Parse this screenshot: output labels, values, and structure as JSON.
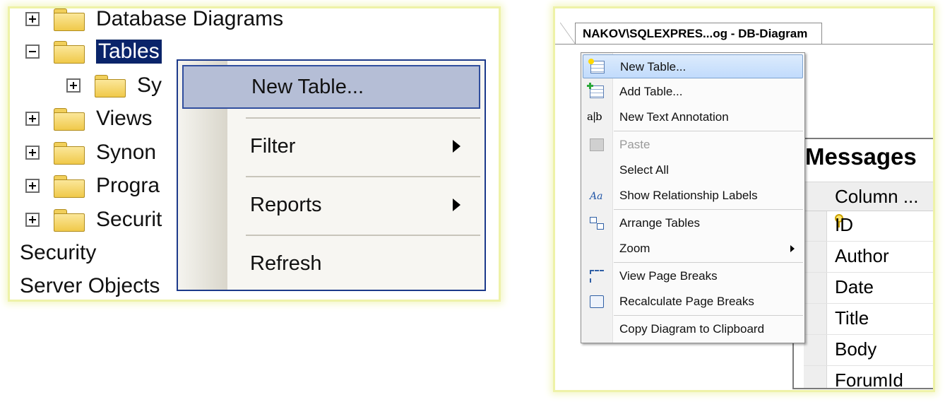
{
  "left": {
    "tree": [
      {
        "label": "Database Diagrams",
        "expander": "plus",
        "folder": true
      },
      {
        "label": "Tables",
        "expander": "minus",
        "folder": true,
        "selected": true
      },
      {
        "label": "Sy",
        "expander": "plus",
        "folder": true
      },
      {
        "label": "Views",
        "expander": "plus",
        "folder": true
      },
      {
        "label": "Synon",
        "expander": "plus",
        "folder": true
      },
      {
        "label": "Progra",
        "expander": "plus",
        "folder": true
      },
      {
        "label": "Securit",
        "expander": "plus",
        "folder": true
      },
      {
        "label": "Security",
        "expander": "none",
        "folder": false
      },
      {
        "label": "Server Objects",
        "expander": "none",
        "folder": false
      }
    ],
    "context_menu": {
      "items": [
        {
          "label": "New Table...",
          "highlighted": true,
          "submenu": false
        },
        {
          "label": "Filter",
          "submenu": true
        },
        {
          "label": "Reports",
          "submenu": true
        },
        {
          "label": "Refresh",
          "submenu": false
        }
      ]
    }
  },
  "right": {
    "tab_title": "NAKOV\\SQLEXPRES...og - DB-Diagram",
    "table": {
      "name": "Messages",
      "column_header": "Column ...",
      "rows": [
        "ID",
        "Author",
        "Date",
        "Title",
        "Body",
        "ForumId"
      ],
      "primary_key": "ID"
    },
    "context_menu": {
      "items": [
        {
          "label": "New Table...",
          "icon": "new-table-icon",
          "highlighted": true
        },
        {
          "label": "Add Table...",
          "icon": "add-table-icon"
        },
        {
          "label": "New Text Annotation",
          "icon": "text-annotation-icon"
        },
        {
          "label": "Paste",
          "icon": "paste-icon",
          "disabled": true
        },
        {
          "label": "Select All",
          "icon": ""
        },
        {
          "label": "Show Relationship Labels",
          "icon": "relationship-labels-icon"
        },
        {
          "label": "Arrange Tables",
          "icon": "arrange-tables-icon"
        },
        {
          "label": "Zoom",
          "icon": "",
          "submenu": true
        },
        {
          "label": "View Page Breaks",
          "icon": "page-breaks-icon"
        },
        {
          "label": "Recalculate Page Breaks",
          "icon": "recalculate-icon"
        },
        {
          "label": "Copy Diagram to Clipboard",
          "icon": ""
        }
      ]
    },
    "icon_text": {
      "text_annotation": "a|b",
      "relationship_labels": "Aa"
    }
  },
  "colors": {
    "selection": "#0a246a",
    "menu_highlight_left": "#b5bed6",
    "menu_highlight_right": "#c1dbfc",
    "panel_glow": "#eef2a8"
  }
}
